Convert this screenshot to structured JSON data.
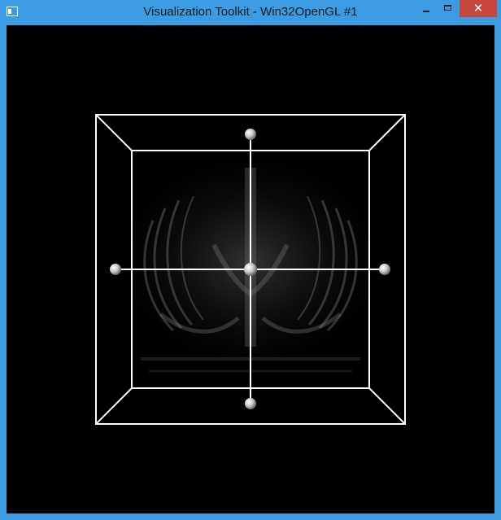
{
  "window": {
    "title": "Visualization Toolkit - Win32OpenGL #1",
    "close_glyph": "✕",
    "icons": {
      "app": "vtk-window-icon",
      "minimize": "minimize-icon",
      "maximize": "maximize-icon",
      "close": "close-icon"
    }
  },
  "viewport": {
    "background": "#000000",
    "widget_color": "#ffffff",
    "handle_color": "#d0d0d0",
    "content": "volume-rendering-with-box-widget",
    "handles": [
      "top-face-handle",
      "bottom-face-handle",
      "left-face-handle",
      "right-face-handle",
      "center-handle"
    ]
  },
  "colors": {
    "titlebar": "#3b9be3",
    "close_button": "#c7463e"
  }
}
